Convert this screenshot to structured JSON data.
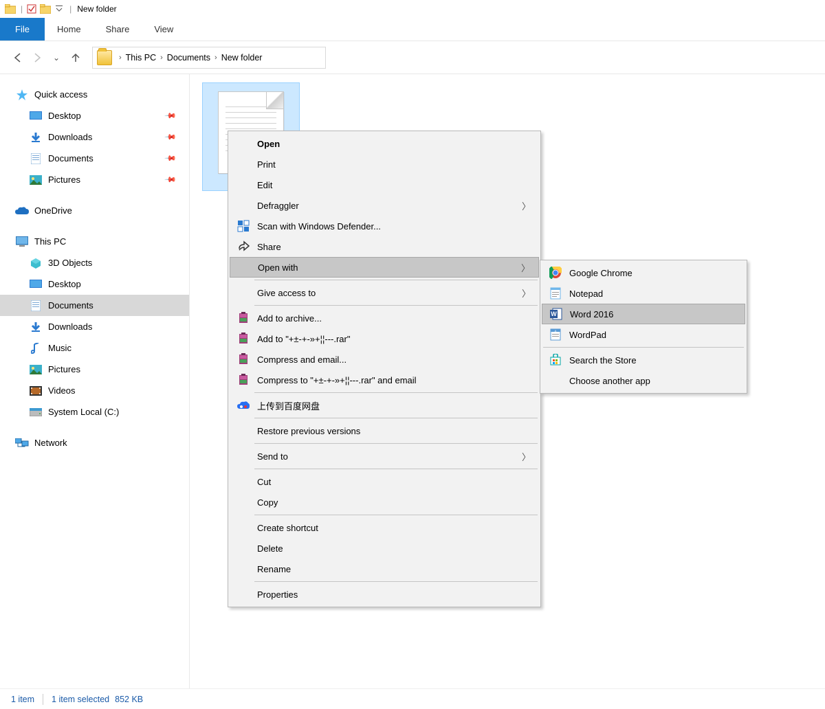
{
  "title": "New folder",
  "ribbon": {
    "file": "File",
    "home": "Home",
    "share": "Share",
    "view": "View"
  },
  "breadcrumb": [
    "This PC",
    "Documents",
    "New folder"
  ],
  "sidebar": {
    "quick": "Quick access",
    "desktop": "Desktop",
    "downloads": "Downloads",
    "documents": "Documents",
    "pictures": "Pictures",
    "onedrive": "OneDrive",
    "thispc": "This PC",
    "objects3d": "3D Objects",
    "desktop2": "Desktop",
    "documents2": "Documents",
    "downloads2": "Downloads",
    "music": "Music",
    "pictures2": "Pictures",
    "videos": "Videos",
    "local": "System Local (C:)",
    "network": "Network"
  },
  "ctx": {
    "open": "Open",
    "print": "Print",
    "edit": "Edit",
    "defraggler": "Defraggler",
    "defender": "Scan with Windows Defender...",
    "share": "Share",
    "openwith": "Open with",
    "access": "Give access to",
    "addarchive": "Add to archive...",
    "addto": "Add to \"+±-+-»+¦¦---.rar\"",
    "compressemail": "Compress and email...",
    "compressto": "Compress to \"+±-+-»+¦¦---.rar\" and email",
    "baidu": "上传到百度网盘",
    "restore": "Restore previous versions",
    "sendto": "Send to",
    "cut": "Cut",
    "copy": "Copy",
    "shortcut": "Create shortcut",
    "delete": "Delete",
    "rename": "Rename",
    "properties": "Properties"
  },
  "sub": {
    "chrome": "Google Chrome",
    "notepad": "Notepad",
    "word": "Word 2016",
    "wordpad": "WordPad",
    "store": "Search the Store",
    "another": "Choose another app"
  },
  "status": {
    "count": "1 item",
    "selected": "1 item selected",
    "size": "852 KB"
  }
}
